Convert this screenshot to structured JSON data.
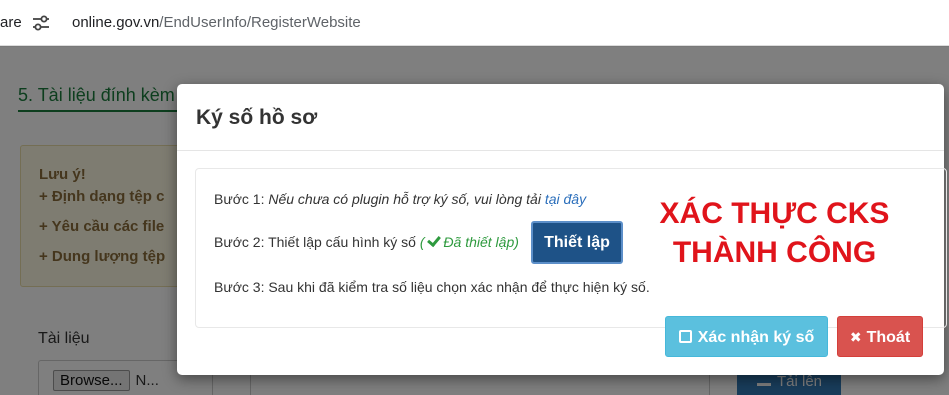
{
  "browser": {
    "left_text": "are",
    "url_host": "online.gov.vn",
    "url_path": "/EndUserInfo/RegisterWebsite",
    "tune_icon": "tune-icon"
  },
  "page": {
    "section_title": "5. Tài liệu đính kèm",
    "note": {
      "title": "Lưu ý!",
      "line1": "+ Định dạng tệp c",
      "line2": "+ Yêu cầu các file",
      "line3": "+ Dung lượng tệp"
    },
    "doc_label": "Tài liệu",
    "browse_label": "Browse...",
    "file_name": "N...",
    "upload_label": "Tải lên"
  },
  "modal": {
    "title": "Ký số hồ sơ",
    "step1_prefix": "Bước 1: ",
    "step1_text": "Nếu chưa có plugin hỗ trợ ký số, vui lòng tải ",
    "step1_link": "tại đây",
    "step2_prefix": "Bước 2: Thiết lập cấu hình ký số ",
    "step2_open": "( ",
    "step2_status": "Đã thiết lập)",
    "setup_button": "Thiết lập",
    "step3": "Bước 3: Sau khi đã kiểm tra số liệu chọn xác nhận để thực hiện ký số.",
    "success_line1": "XÁC THỰC CKS",
    "success_line2": "THÀNH CÔNG",
    "confirm_button": "Xác nhận ký số",
    "exit_button": "Thoát"
  },
  "colors": {
    "success_red": "#e0141b",
    "setup_blue": "#1e5287",
    "confirm_cyan": "#5bc0de",
    "exit_red": "#d9534f",
    "status_green": "#2e9a3e"
  }
}
